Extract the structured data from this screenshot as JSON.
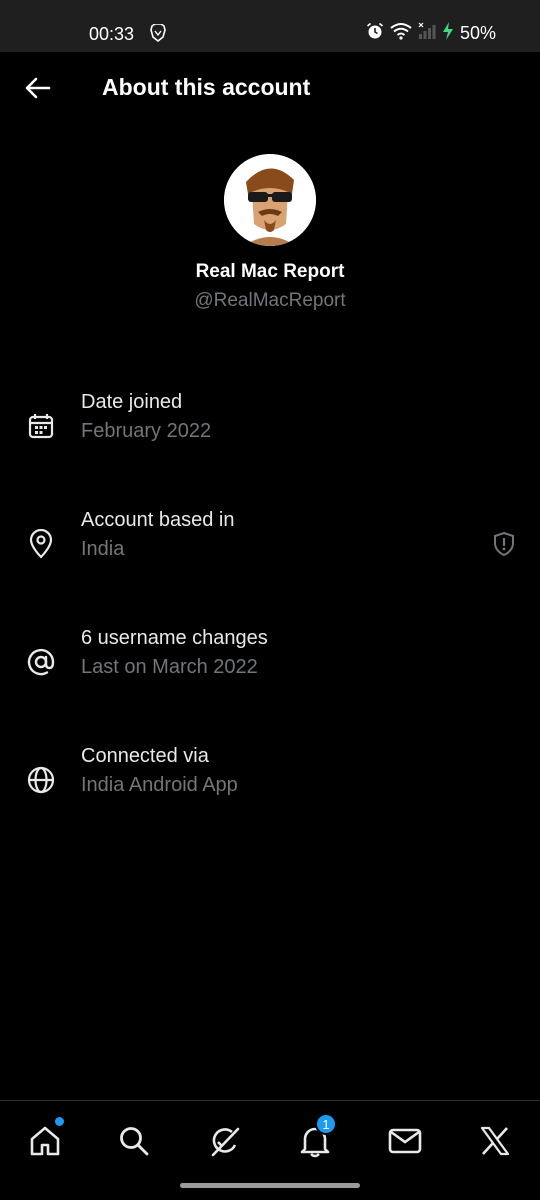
{
  "status_bar": {
    "time": "00:33",
    "battery": "50%"
  },
  "header": {
    "title": "About this account"
  },
  "profile": {
    "name": "Real Mac Report",
    "handle": "@RealMacReport"
  },
  "rows": [
    {
      "label": "Date joined",
      "value": "February 2022",
      "icon": "calendar-icon"
    },
    {
      "label": "Account based in",
      "value": "India",
      "icon": "location-pin-icon",
      "trailing_icon": "shield-alert-icon"
    },
    {
      "label": "6 username changes",
      "value": "Last on March 2022",
      "icon": "at-icon"
    },
    {
      "label": "Connected via",
      "value": "India Android App",
      "icon": "globe-icon"
    }
  ],
  "bottom_nav": {
    "items": [
      "home",
      "search",
      "grok",
      "notifications",
      "messages",
      "x-premium"
    ],
    "notifications_badge": "1"
  },
  "colors": {
    "accent": "#1d9bf0",
    "secondary_text": "#71767b",
    "background": "#000000"
  }
}
